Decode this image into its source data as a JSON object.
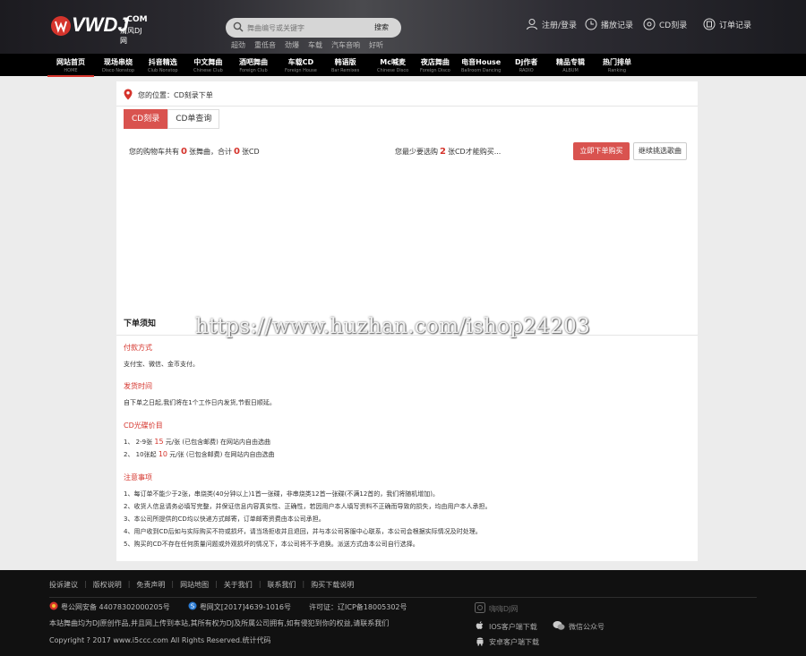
{
  "header": {
    "logo_text": "VWDJ",
    "logo_sub": "清风DJ网",
    "logo_com": ".COM",
    "search": {
      "placeholder": "舞曲编号或关键字",
      "button": "搜索"
    },
    "hot_keywords": [
      "超劲",
      "重低音",
      "劲爆",
      "车载",
      "汽车音响",
      "好听"
    ],
    "user_links": {
      "login": "注册/登录",
      "history": "播放记录",
      "cd_burn": "CD刻录",
      "orders": "订单记录"
    }
  },
  "nav": [
    {
      "cn": "网站首页",
      "en": "HOME"
    },
    {
      "cn": "现场串烧",
      "en": "Disco Nonstop"
    },
    {
      "cn": "抖音精选",
      "en": "Club Nonstop"
    },
    {
      "cn": "中文舞曲",
      "en": "Chinese Club"
    },
    {
      "cn": "酒吧舞曲",
      "en": "Foreign Club"
    },
    {
      "cn": "车载CD",
      "en": "Foreign House"
    },
    {
      "cn": "韩语版",
      "en": "Bar Remixes"
    },
    {
      "cn": "Mc喊麦",
      "en": "Chinese Disco"
    },
    {
      "cn": "夜店舞曲",
      "en": "Foreign Disco"
    },
    {
      "cn": "电音House",
      "en": "Ballroom Dancing"
    },
    {
      "cn": "Dj作者",
      "en": "RADIO"
    },
    {
      "cn": "精品专辑",
      "en": "ALBUM"
    },
    {
      "cn": "热门排单",
      "en": "Ranking"
    }
  ],
  "breadcrumb": "您的位置：CD刻录下单",
  "tabs": [
    "CD刻录",
    "CD单查询"
  ],
  "cart": {
    "prefix": "您的购物车共有",
    "count": "0",
    "middle": "张舞曲，合计",
    "cds": "0",
    "suffix": "张CD"
  },
  "need": {
    "prefix": "您最少要选购",
    "count": "2",
    "suffix": "张CD才能购买..."
  },
  "buttons": {
    "order": "立即下单购买",
    "continue": "继续挑选歌曲"
  },
  "notice": {
    "title": "下单须知",
    "payment": {
      "title": "付款方式",
      "text": "支付宝、微信、金币支付。"
    },
    "shipping": {
      "title": "发货时间",
      "text": "自下单之日起,我们将在1个工作日内发货,节假日顺延。"
    },
    "price": {
      "title": "CD光碟价目",
      "line1_a": "1、 2-9张",
      "line1_price": "15",
      "line1_b": "元/张 (已包含邮费) 在网站内自由选曲",
      "line2_a": "2、 10张起",
      "line2_price": "10",
      "line2_b": "元/张 (已包含邮费) 在网站内自由选曲"
    },
    "notes": {
      "title": "注意事项",
      "items": [
        "1、每订单不能少于2张，串烧类(40分钟以上)1首一张碟，非串烧类12首一张碟(不满12首的，我们将随机增加)。",
        "2、收货人信息请务必填写完整，并保证信息内容真实性、正确性，若因用户本人填写资料不正确而导致的损失，均由用户本人承担。",
        "3、本公司所提供的CD均以快递方式邮寄，订单邮寄资费由本公司承担。",
        "4、用户收到CD后如与实际购买不符或损坏，请当场拒收并且退回，并与本公司客服中心联系，本公司会根据实际情况及时处理。",
        "5、购买的CD不存在任何质量问题或外观损坏的情况下，本公司将不予退换。派送方式由本公司自行选择。"
      ]
    }
  },
  "watermark": "https://www.huzhan.com/ishop24203",
  "footer": {
    "links": [
      "投诉建议",
      "版权说明",
      "免责声明",
      "网站地图",
      "关于我们",
      "联系我们",
      "购买下载说明"
    ],
    "police": "粤公网安备 44078302000205号",
    "culture": "粤网文[2017]4639-1016号",
    "icp": "许可证：辽ICP备18005302号",
    "statement": "本站舞曲均为DJ原创作品,并且网上传到本站,其所有权为DJ及所属公司拥有,如有侵犯到你的权益,请联系我们",
    "copyright": "Copyright ? 2017 www.i5ccc.com All Rights Reserved.统计代码",
    "brand": "嗨嗨DJ网",
    "ios": "IOS客户端下载",
    "android": "安卓客户端下载",
    "wechat": "微信公众号"
  },
  "colors": {
    "accent": "#d9534f",
    "header_bg": "#1c1b20",
    "nav_bg": "#000000",
    "footer_bg": "#111111"
  }
}
